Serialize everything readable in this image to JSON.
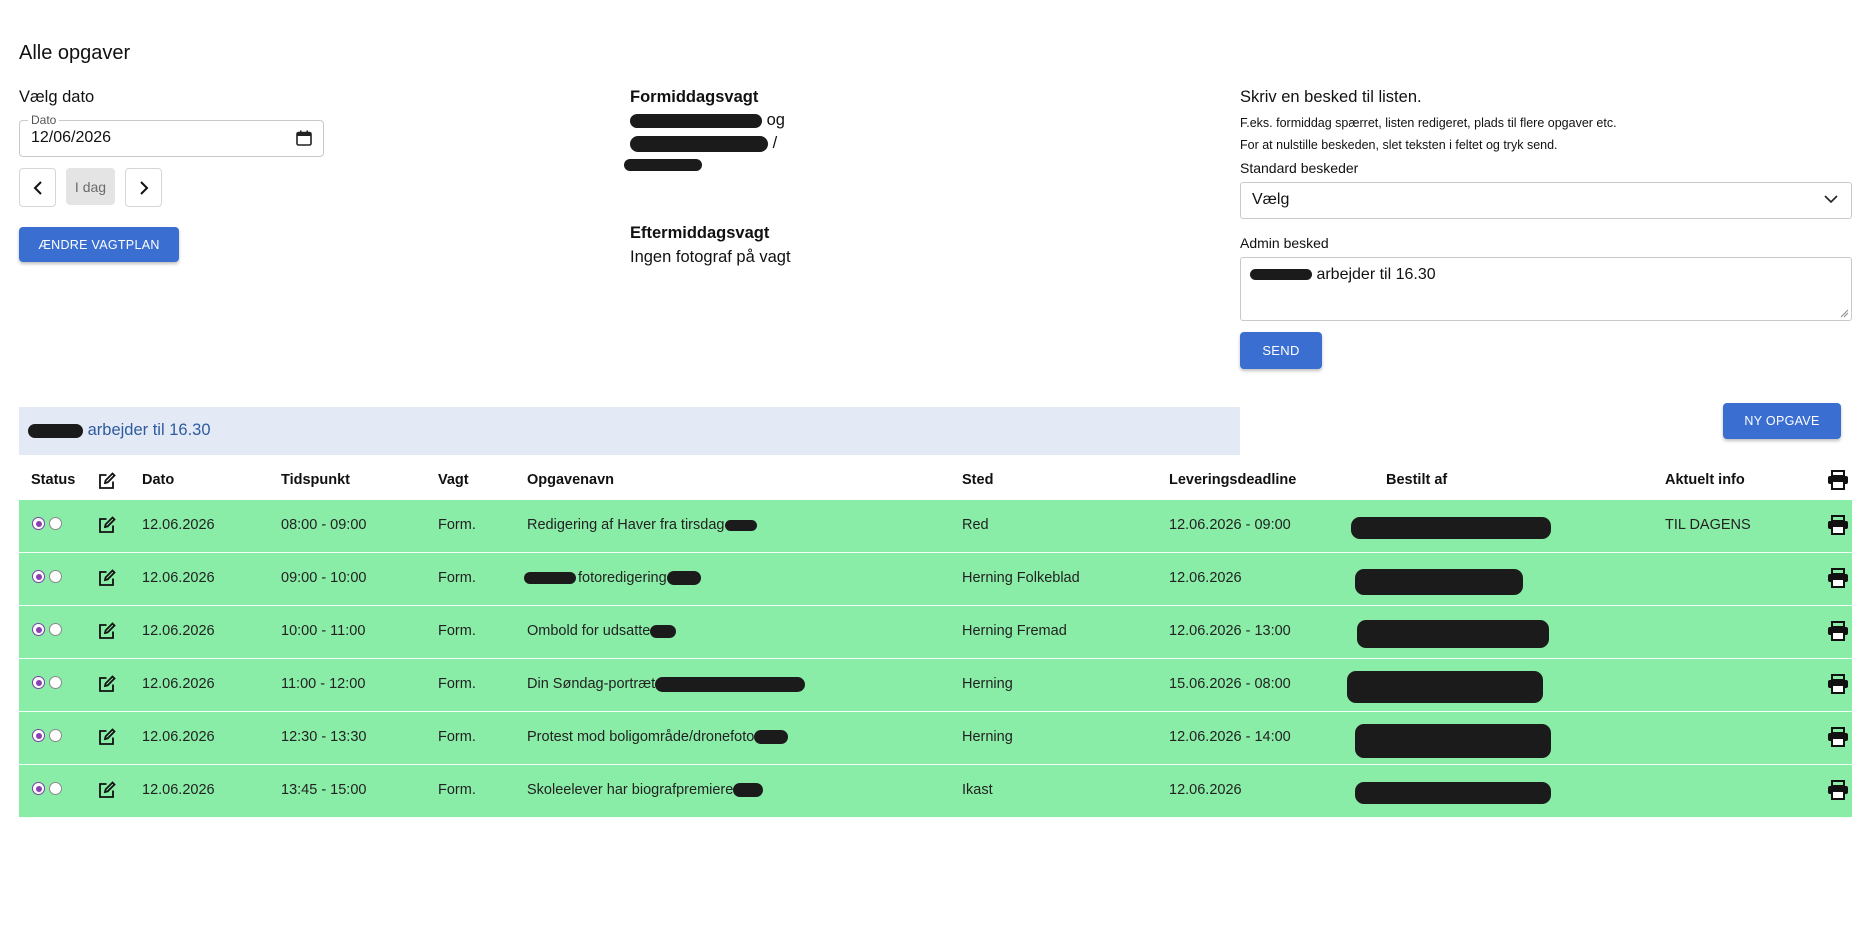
{
  "page": {
    "title": "Alle opgaver"
  },
  "date_section": {
    "label": "Vælg dato",
    "field_legend": "Dato",
    "field_value": "12/06/2026",
    "today_label": "I dag",
    "change_button": "ÆNDRE VAGTPLAN"
  },
  "shifts": {
    "morning_title": "Formiddagsvagt",
    "morning_conj": "og",
    "morning_sep": "/",
    "afternoon_title": "Eftermiddagsvagt",
    "afternoon_text": "Ingen fotograf på vagt"
  },
  "message": {
    "heading": "Skriv en besked til listen.",
    "hint1": "F.eks. formiddag spærret, listen redigeret, plads til flere opgaver etc.",
    "hint2": "For at nulstille beskeden, slet teksten i feltet og tryk send.",
    "standard_label": "Standard beskeder",
    "standard_value": "Vælg",
    "admin_label": "Admin besked",
    "admin_value": "arbejder til 16.30",
    "send_label": "SEND"
  },
  "banner": {
    "text": "arbejder til 16.30"
  },
  "new_task_label": "NY OPGAVE",
  "table": {
    "headers": {
      "status": "Status",
      "dato": "Dato",
      "tidspunkt": "Tidspunkt",
      "vagt": "Vagt",
      "opgavenavn": "Opgavenavn",
      "sted": "Sted",
      "deadline": "Leveringsdeadline",
      "bestilt": "Bestilt af",
      "info": "Aktuelt info"
    },
    "rows": [
      {
        "dato": "12.06.2026",
        "tid": "08:00 - 09:00",
        "vagt": "Form.",
        "navn": "Redigering af Haver fra tirsdag",
        "sted": "Red",
        "deadline": "12.06.2026 - 09:00",
        "info": "TIL DAGENS"
      },
      {
        "dato": "12.06.2026",
        "tid": "09:00 - 10:00",
        "vagt": "Form.",
        "navn": "fotoredigering",
        "sted": "Herning Folkeblad",
        "deadline": "12.06.2026",
        "info": ""
      },
      {
        "dato": "12.06.2026",
        "tid": "10:00 - 11:00",
        "vagt": "Form.",
        "navn": "Ombold for udsatte",
        "sted": "Herning Fremad",
        "deadline": "12.06.2026 - 13:00",
        "info": ""
      },
      {
        "dato": "12.06.2026",
        "tid": "11:00 - 12:00",
        "vagt": "Form.",
        "navn": "Din Søndag-portræt",
        "sted": "Herning",
        "deadline": "15.06.2026 - 08:00",
        "info": ""
      },
      {
        "dato": "12.06.2026",
        "tid": "12:30 - 13:30",
        "vagt": "Form.",
        "navn": "Protest mod boligområde/dronefoto",
        "sted": "Herning",
        "deadline": "12.06.2026 - 14:00",
        "info": ""
      },
      {
        "dato": "12.06.2026",
        "tid": "13:45 - 15:00",
        "vagt": "Form.",
        "navn": "Skoleelever har biografpremiere",
        "sted": "Ikast",
        "deadline": "12.06.2026",
        "info": ""
      }
    ]
  },
  "colors": {
    "accent": "#3a6fd1",
    "row_bg": "#8aeda7",
    "banner_bg": "#e3eaf6",
    "radio_on": "#8a3fb3"
  },
  "icons": [
    "calendar-icon",
    "chevron-left-icon",
    "chevron-right-icon",
    "chevron-down-icon",
    "edit-icon",
    "printer-icon"
  ]
}
